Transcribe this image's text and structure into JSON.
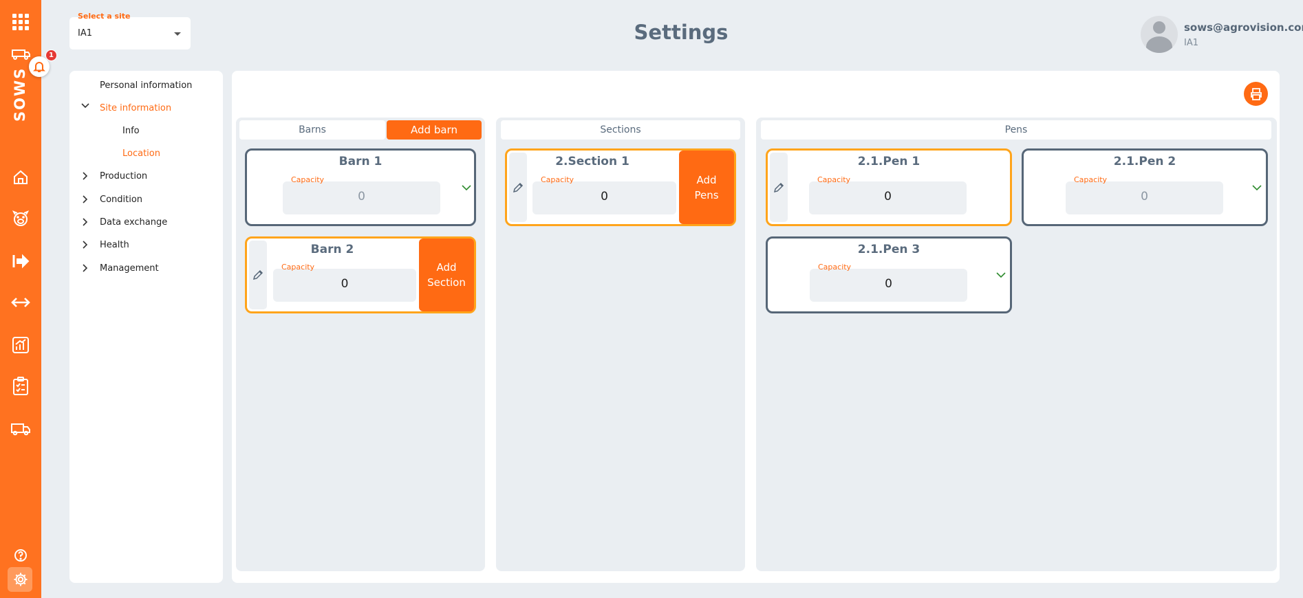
{
  "app": {
    "brand": "SOWS",
    "notification_count": "1"
  },
  "site_select": {
    "label": "Select a site",
    "value": "IA1"
  },
  "page_title": "Settings",
  "user": {
    "email": "sows@agrovision.com",
    "site": "IA1"
  },
  "nav": {
    "personal": "Personal information",
    "site_info": "Site information",
    "info": "Info",
    "location": "Location",
    "production": "Production",
    "condition": "Condition",
    "data_exchange": "Data exchange",
    "health": "Health",
    "management": "Management"
  },
  "barns": {
    "header": "Barns",
    "add_label": "Add barn",
    "items": [
      {
        "title": "Barn 1",
        "capacity_label": "Capacity",
        "capacity": "0"
      },
      {
        "title": "Barn 2",
        "capacity_label": "Capacity",
        "capacity": "0",
        "action": "Add\nSection"
      }
    ]
  },
  "sections": {
    "header": "Sections",
    "items": [
      {
        "title": "2.Section 1",
        "capacity_label": "Capacity",
        "capacity": "0",
        "action": "Add\nPens"
      }
    ]
  },
  "pens": {
    "header": "Pens",
    "items": [
      {
        "title": "2.1.Pen 1",
        "capacity_label": "Capacity",
        "capacity": "0"
      },
      {
        "title": "2.1.Pen 2",
        "capacity_label": "Capacity",
        "capacity": "0"
      },
      {
        "title": "2.1.Pen 3",
        "capacity_label": "Capacity",
        "capacity": "0"
      }
    ]
  },
  "icons": [
    "apps-grid-icon",
    "truck-trailer-icon",
    "bell-icon",
    "home-icon",
    "pig-icon",
    "exit-arrow-icon",
    "transfer-arrows-icon",
    "chart-icon",
    "checklist-icon",
    "truck-icon",
    "help-icon",
    "gear-icon",
    "printer-icon",
    "pencil-icon",
    "chevron-down-icon"
  ],
  "colors": {
    "accent": "#ff6a13",
    "selected_border": "#ffa41b",
    "card_border": "#566677",
    "expand_chevron": "#2e8b2e"
  }
}
